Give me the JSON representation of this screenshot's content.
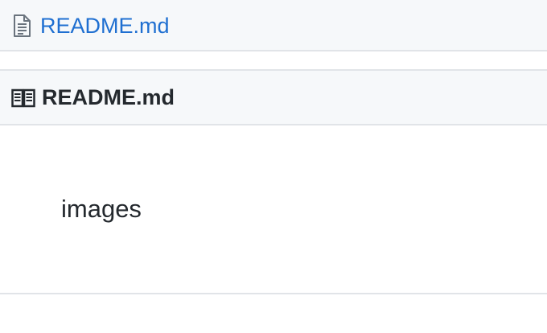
{
  "file_list": {
    "item": {
      "name": "README.md",
      "icon": "file-text-icon"
    }
  },
  "readme": {
    "header_icon": "book-icon",
    "title": "README.md",
    "content": "images"
  },
  "colors": {
    "link": "#1f6fd1",
    "header_bg": "#f6f8fa",
    "border": "#e1e4e8",
    "text": "#24292e"
  }
}
